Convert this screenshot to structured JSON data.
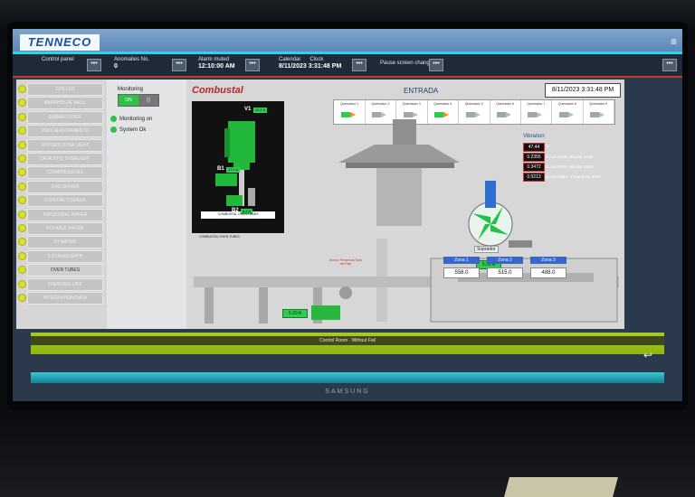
{
  "header": {
    "brand": "TENNECO"
  },
  "infobar": {
    "control_panel": "Control panel",
    "anomalies_label": "Anomalies No.",
    "anomalies_value": "0",
    "alarm_label": "Alarm muted",
    "alarm_value": "12:10:00 AM",
    "calendar_label": "Calendar",
    "clock_label": "Clock",
    "datetime_value": "8/11/2023 3:31:48 PM",
    "pause_label": "Pause screen chang",
    "dots": "•••"
  },
  "sidebar": {
    "items": [
      {
        "label": "CHILLER",
        "active": false
      },
      {
        "label": "BARRHOLDE WELL",
        "active": false
      },
      {
        "label": "EMBAR FILTER",
        "active": false
      },
      {
        "label": "PRECALENTAMIENTO",
        "active": false
      },
      {
        "label": "ROTORS DYNA LIGHT",
        "active": false
      },
      {
        "label": "CATALYTIC DYNALIGHT",
        "active": false
      },
      {
        "label": "COMPRESSORS",
        "active": false
      },
      {
        "label": "GAS DRIVER",
        "active": false
      },
      {
        "label": "COOLING TOWERS",
        "active": false
      },
      {
        "label": "INDUSTRIAL WATER",
        "active": false
      },
      {
        "label": "POTABLE WATER",
        "active": false
      },
      {
        "label": "DI WATER",
        "active": false
      },
      {
        "label": "5 STAGES BATH",
        "active": false
      },
      {
        "label": "OVEN TUBES",
        "active": true
      },
      {
        "label": "FINISHING LINE",
        "active": false
      },
      {
        "label": "INTEGRATION DATA",
        "active": false
      }
    ]
  },
  "monitoring": {
    "title": "Monitoring",
    "toggle_on": "ON",
    "toggle_off": "|||",
    "status_monitoring": "Monitoring on",
    "status_system": "System Ok"
  },
  "main": {
    "brand": "Combustal",
    "title": "ENTRADA",
    "date": "8/11/2023 3:31:48 PM",
    "motor_panel": {
      "v1": "V1",
      "b1": "B1",
      "b2": "B2",
      "caption": "COMBUSTAL OVEN TUBES",
      "v1_value": "43.1 A",
      "b1_value": "17.1 A",
      "b2_value": "6.8 A"
    },
    "motor_caption_below": "COMBUSTAL OVEN TUBES",
    "burners": [
      "Quemador 1",
      "Quemador 2",
      "Quemador 3",
      "Quemador 4",
      "Quemador 5",
      "Quemador 6",
      "Quemador 7",
      "Quemador 8",
      "Quemador 9"
    ],
    "vibration": {
      "title": "Vibration",
      "rows": [
        {
          "value": "47.44",
          "label": "°F"
        },
        {
          "value": "0.2355",
          "label": "Z Axis RMS Velocity mm/s"
        },
        {
          "value": "0.3472",
          "label": "X Axis RMS Velocity mm/s"
        },
        {
          "value": "0.0213",
          "label": "Z Axis Hight - Frequency RMS"
        }
      ]
    },
    "fan_label": "Soprador",
    "fan_current": "5.00 A",
    "sensor_label": "Sensor Presencia Tubo del Piso",
    "motor_current": "5.00 A",
    "zones": [
      {
        "name": "Zona 1",
        "value": "558.0"
      },
      {
        "name": "Zona 2",
        "value": "515.0"
      },
      {
        "name": "Zona 3",
        "value": "488.0"
      }
    ]
  },
  "footer": {
    "text": "Control Room · Without Fail"
  },
  "monitor_brand": "SAMSUNG",
  "colors": {
    "accent_green": "#2fcc50",
    "topbar_blue": "#6f98c5",
    "sidebar_led": "#d8e22a",
    "footer_lime": "#a7cc22"
  }
}
